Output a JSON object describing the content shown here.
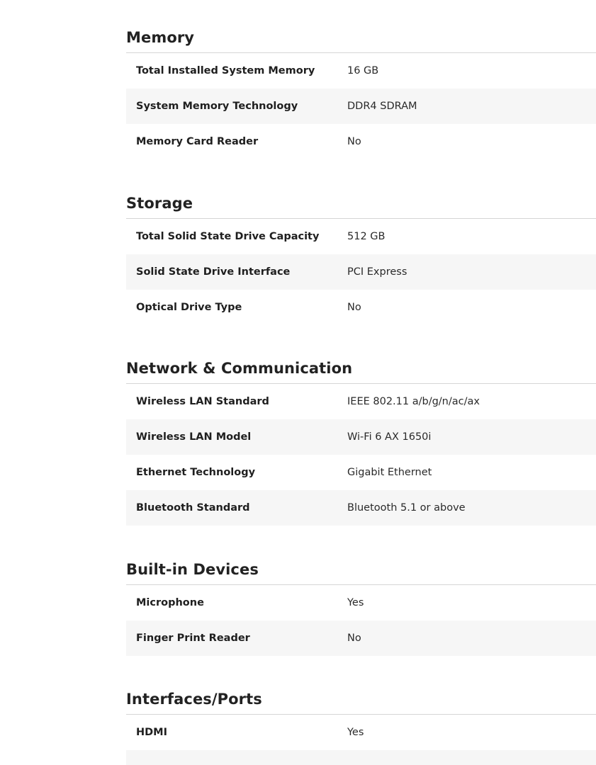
{
  "sections": [
    {
      "title": "Memory",
      "rows": [
        {
          "label": "Total Installed System Memory",
          "value": "16 GB"
        },
        {
          "label": "System Memory Technology",
          "value": "DDR4 SDRAM"
        },
        {
          "label": "Memory Card Reader",
          "value": "No"
        }
      ]
    },
    {
      "title": "Storage",
      "rows": [
        {
          "label": "Total Solid State Drive Capacity",
          "value": "512 GB"
        },
        {
          "label": "Solid State Drive Interface",
          "value": "PCI Express"
        },
        {
          "label": "Optical Drive Type",
          "value": "No"
        }
      ]
    },
    {
      "title": "Network & Communication",
      "rows": [
        {
          "label": "Wireless LAN Standard",
          "value": "IEEE 802.11 a/b/g/n/ac/ax"
        },
        {
          "label": "Wireless LAN Model",
          "value": "Wi-Fi 6 AX 1650i"
        },
        {
          "label": "Ethernet Technology",
          "value": "Gigabit Ethernet"
        },
        {
          "label": "Bluetooth Standard",
          "value": "Bluetooth 5.1 or above"
        }
      ]
    },
    {
      "title": "Built-in Devices",
      "rows": [
        {
          "label": "Microphone",
          "value": "Yes"
        },
        {
          "label": "Finger Print Reader",
          "value": "No"
        }
      ]
    },
    {
      "title": "Interfaces/Ports",
      "rows": [
        {
          "label": "HDMI",
          "value": "Yes"
        },
        {
          "label": "",
          "value": ""
        }
      ]
    }
  ]
}
